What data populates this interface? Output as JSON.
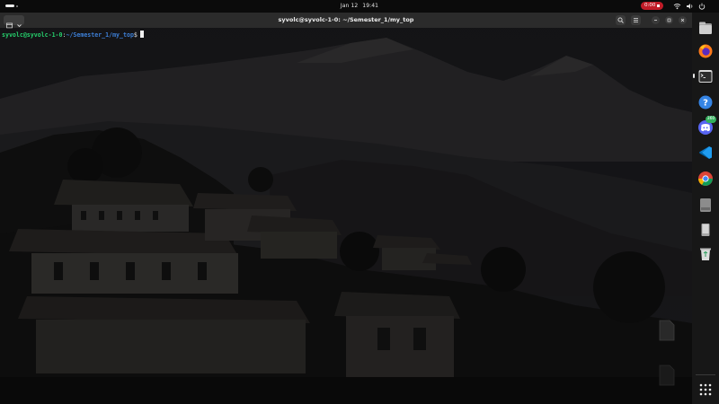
{
  "topbar": {
    "date": "Jan 12",
    "time": "19:41",
    "recording_time": "0:00",
    "icons": [
      "network-icon",
      "volume-icon",
      "power-icon"
    ]
  },
  "terminal": {
    "window_title": "syvolc@syvolc-1-0: ~/Semester_1/my_top",
    "prompt": {
      "user_host": "syvolc@syvolc-1-0",
      "colon": ":",
      "path": "~/Semester_1/my_top",
      "symbol": "$"
    }
  },
  "dock": {
    "apps": [
      {
        "name": "files",
        "running": false
      },
      {
        "name": "firefox",
        "running": false
      },
      {
        "name": "terminal",
        "running": true
      },
      {
        "name": "help",
        "running": false
      },
      {
        "name": "discord",
        "running": false,
        "badge": "360"
      },
      {
        "name": "vscode",
        "running": false
      },
      {
        "name": "chrome",
        "running": false
      },
      {
        "name": "disk-drive",
        "running": false
      },
      {
        "name": "removable-drive",
        "running": false
      },
      {
        "name": "trash",
        "running": false
      },
      {
        "name": "show-apps",
        "running": false
      }
    ]
  },
  "colors": {
    "prompt_user": "#26d06d",
    "prompt_path": "#3d7fd6",
    "record_red": "#c01c28",
    "dock_bg": "#171717"
  }
}
